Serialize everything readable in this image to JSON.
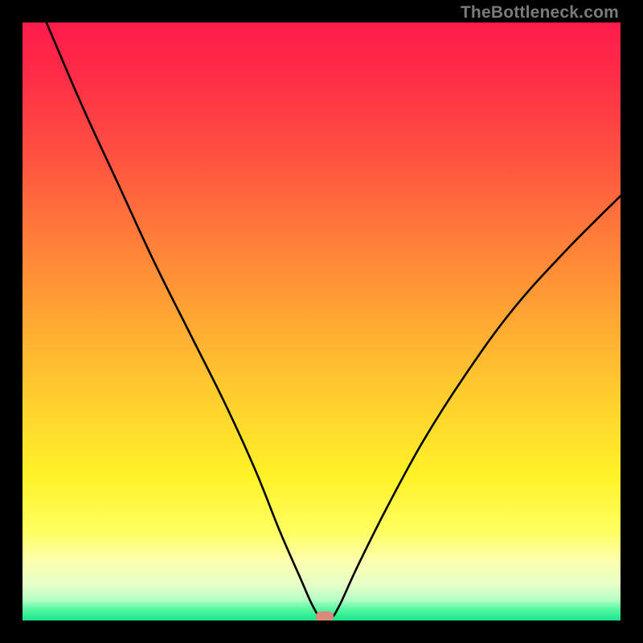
{
  "watermark": "TheBottleneck.com",
  "chart_data": {
    "type": "line",
    "title": "",
    "xlabel": "",
    "ylabel": "",
    "xlim": [
      0,
      100
    ],
    "ylim": [
      0,
      100
    ],
    "grid": false,
    "series": [
      {
        "name": "curve",
        "x": [
          4,
          10,
          16,
          22,
          28,
          34,
          39,
          43,
          46.5,
          48.5,
          50,
          51.5,
          53,
          56,
          61,
          67,
          74,
          82,
          91,
          100
        ],
        "y": [
          100,
          86,
          73,
          60,
          48,
          36,
          25,
          15,
          7,
          2.5,
          0.3,
          0.3,
          2.5,
          9,
          19,
          30,
          41,
          52,
          62,
          71
        ]
      }
    ],
    "annotations": [
      {
        "name": "min-marker",
        "x": 50.5,
        "y": 0.7,
        "color": "#d98a7a"
      }
    ],
    "background": {
      "type": "vertical-gradient",
      "stops": [
        {
          "pos": 0,
          "color": "#ff1b4b"
        },
        {
          "pos": 50,
          "color": "#ffa833"
        },
        {
          "pos": 85,
          "color": "#ffff60"
        },
        {
          "pos": 100,
          "color": "#18e68a"
        }
      ]
    }
  }
}
